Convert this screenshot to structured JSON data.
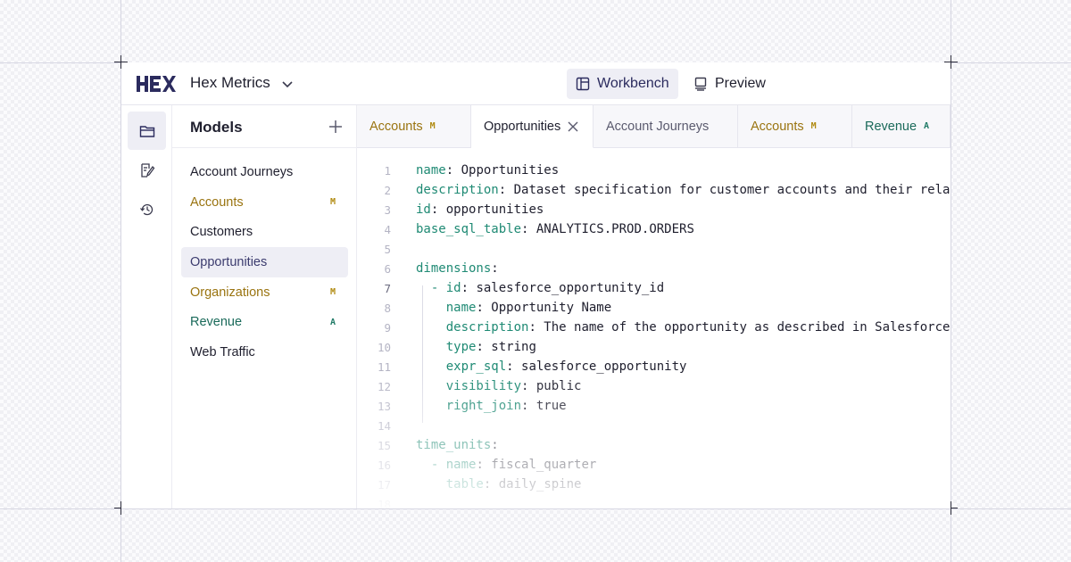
{
  "app": {
    "title": "Hex Metrics",
    "logo_text": "HEX"
  },
  "modes": {
    "workbench": "Workbench",
    "preview": "Preview"
  },
  "sidebar": {
    "title": "Models",
    "items": [
      {
        "label": "Account Journeys",
        "badge": ""
      },
      {
        "label": "Accounts",
        "badge": "M"
      },
      {
        "label": "Customers",
        "badge": ""
      },
      {
        "label": "Opportunities",
        "badge": ""
      },
      {
        "label": "Organizations",
        "badge": "M"
      },
      {
        "label": "Revenue",
        "badge": "A"
      },
      {
        "label": "Web Traffic",
        "badge": ""
      }
    ]
  },
  "tabs": [
    {
      "label": "Accounts",
      "badge": "M"
    },
    {
      "label": "Opportunities",
      "badge": ""
    },
    {
      "label": "Account Journeys",
      "badge": ""
    },
    {
      "label": "Accounts",
      "badge": "M"
    },
    {
      "label": "Revenue",
      "badge": "A"
    }
  ],
  "editor": {
    "line_numbers": [
      "1",
      "2",
      "3",
      "4",
      "5",
      "6",
      "7",
      "8",
      "9",
      "10",
      "11",
      "12",
      "13",
      "14",
      "15",
      "16",
      "17",
      "18"
    ],
    "current_line": "7",
    "lines": [
      {
        "prefix": "",
        "key": "name",
        "value": " Opportunities"
      },
      {
        "prefix": "",
        "key": "description",
        "value": " Dataset specification for customer accounts and their relationships"
      },
      {
        "prefix": "",
        "key": "id",
        "value": " opportunities"
      },
      {
        "prefix": "",
        "key": "base_sql_table",
        "value": " ANALYTICS.PROD.ORDERS"
      },
      {
        "prefix": "",
        "key": "",
        "value": ""
      },
      {
        "prefix": "",
        "key": "dimensions",
        "value": ""
      },
      {
        "prefix": "  - ",
        "key": "id",
        "value": " salesforce_opportunity_id"
      },
      {
        "prefix": "    ",
        "key": "name",
        "value": " Opportunity Name"
      },
      {
        "prefix": "    ",
        "key": "description",
        "value": " The name of the opportunity as described in Salesforce"
      },
      {
        "prefix": "    ",
        "key": "type",
        "value": " string"
      },
      {
        "prefix": "    ",
        "key": "expr_sql",
        "value": " salesforce_opportunity"
      },
      {
        "prefix": "    ",
        "key": "visibility",
        "value": " public"
      },
      {
        "prefix": "    ",
        "key": "right_join",
        "value": " true"
      },
      {
        "prefix": "",
        "key": "",
        "value": ""
      },
      {
        "prefix": "",
        "key": "time_units",
        "value": ""
      },
      {
        "prefix": "  - ",
        "key": "name",
        "value": " fiscal_quarter"
      },
      {
        "prefix": "    ",
        "key": "table",
        "value": " daily_spine"
      },
      {
        "prefix": "",
        "key": "",
        "value": ""
      }
    ]
  }
}
